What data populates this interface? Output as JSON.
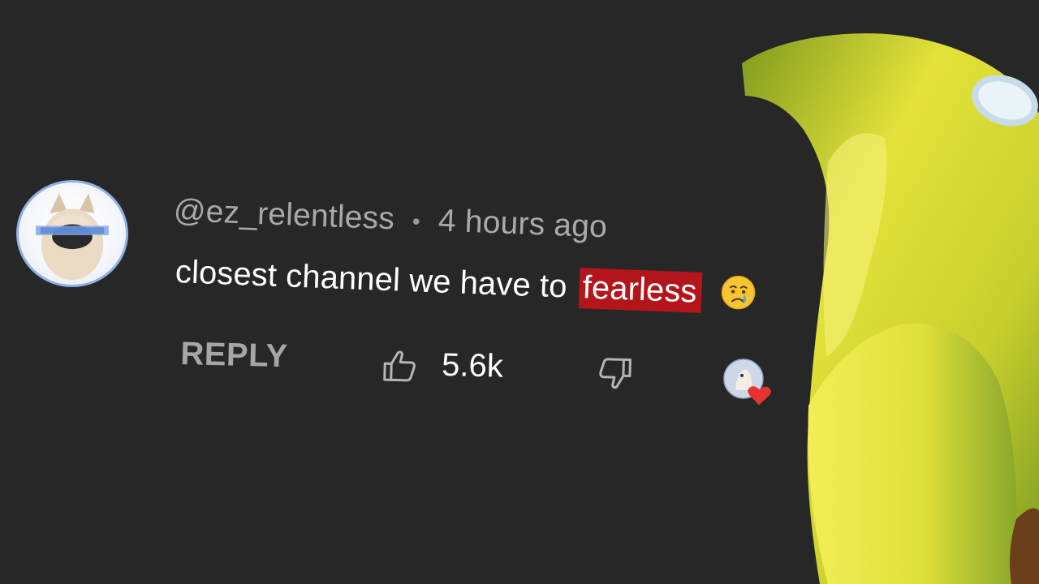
{
  "comment": {
    "username": "@ez_relentless",
    "separator": "•",
    "timestamp": "4 hours ago",
    "text_before": "closest channel we have to",
    "text_highlight": "fearless",
    "highlight_color": "#b3151a",
    "emoji": "crying-face"
  },
  "actions": {
    "reply_label": "REPLY",
    "like_count": "5.6k",
    "like_icon": "thumbs-up-icon",
    "dislike_icon": "thumbs-down-icon",
    "creator_heart": "creator-heart-badge"
  },
  "colors": {
    "background": "#272727",
    "meta_text": "#a9a9a9",
    "comment_text": "#ffffff",
    "heart": "#e8322f"
  }
}
